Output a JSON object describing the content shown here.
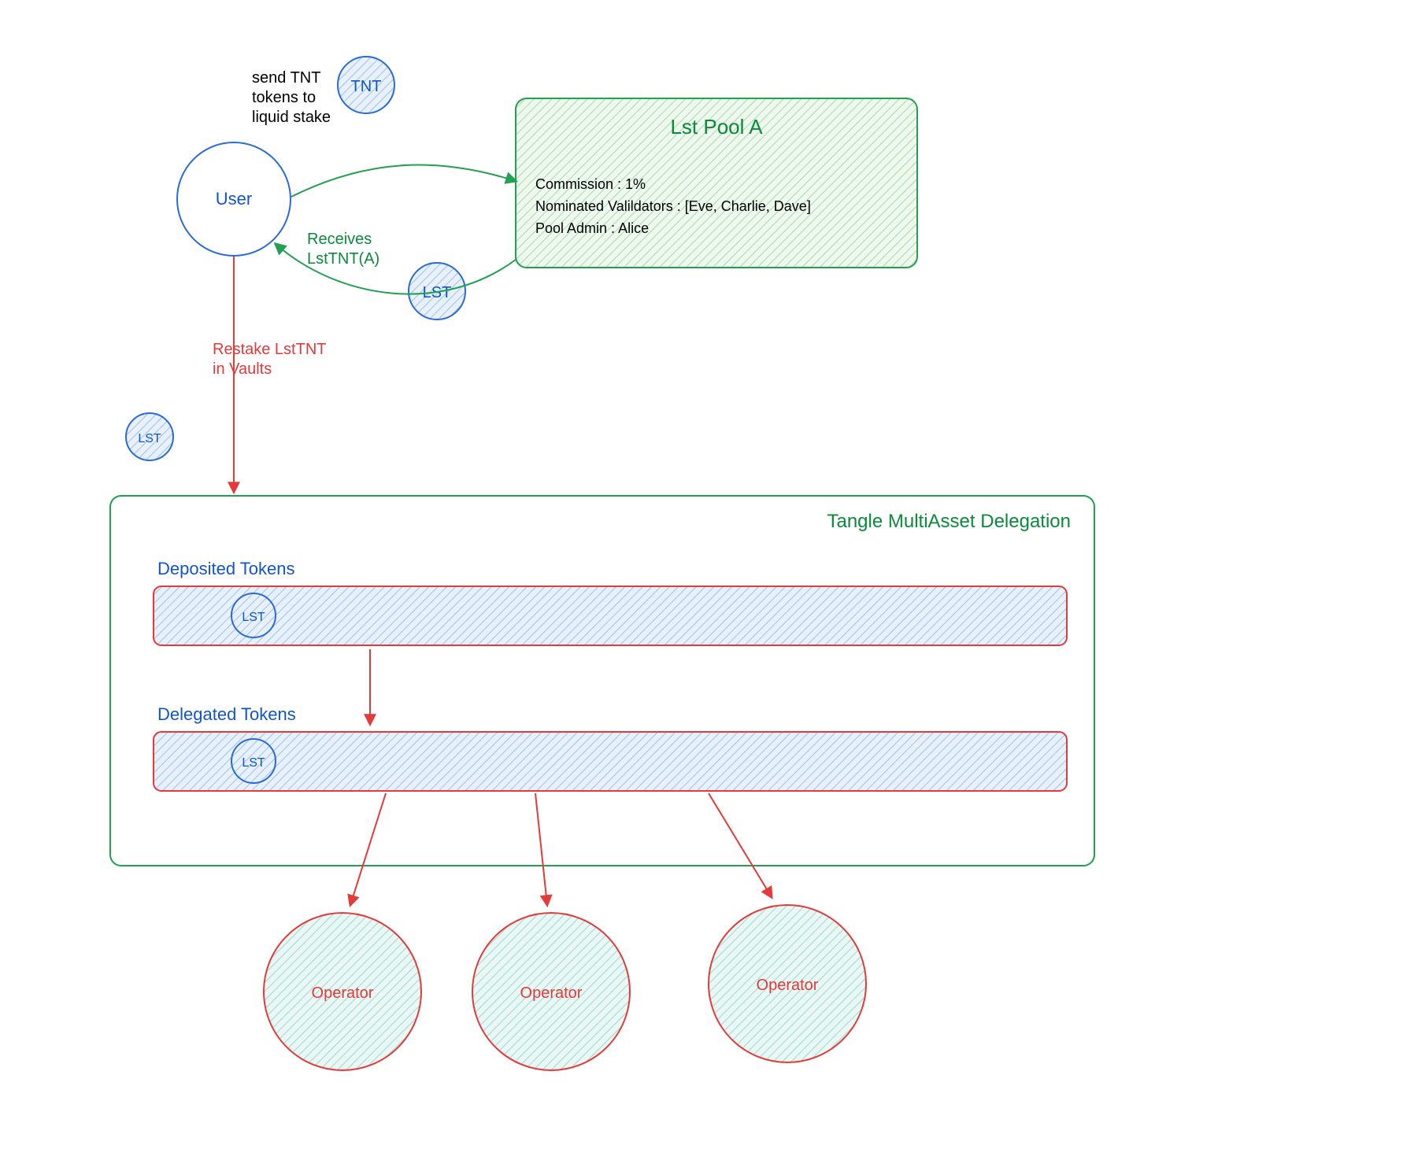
{
  "user": {
    "label": "User"
  },
  "token_tnt": {
    "label": "TNT"
  },
  "token_lst": {
    "label": "LST"
  },
  "arrow_send": {
    "label_line1": "send TNT",
    "label_line2": "tokens to",
    "label_line3": "liquid stake"
  },
  "arrow_receive": {
    "label_line1": "Receives",
    "label_line2": "LstTNT(A)"
  },
  "arrow_restake": {
    "label_line1": "Restake LstTNT",
    "label_line2": "in Vaults"
  },
  "pool": {
    "title": "Lst Pool A",
    "commission_label": "Commission : 1%",
    "validators_label": "Nominated Valildators : [Eve, Charlie, Dave]",
    "admin_label": "Pool Admin : Alice"
  },
  "delegation": {
    "title": "Tangle MultiAsset Delegation",
    "deposited_label": "Deposited Tokens",
    "delegated_label": "Delegated Tokens"
  },
  "operator": {
    "label": "Operator"
  },
  "colors": {
    "blue": "#1155cc",
    "blue_stroke": "#2a6bd6",
    "green": "#20a050",
    "green_dark": "#0a8a3a",
    "red": "#e33a3a",
    "black": "#000000",
    "hatch_blue": "#cfe2f7",
    "hatch_green": "#dff1df",
    "hatch_teal": "#d5f0ec"
  }
}
